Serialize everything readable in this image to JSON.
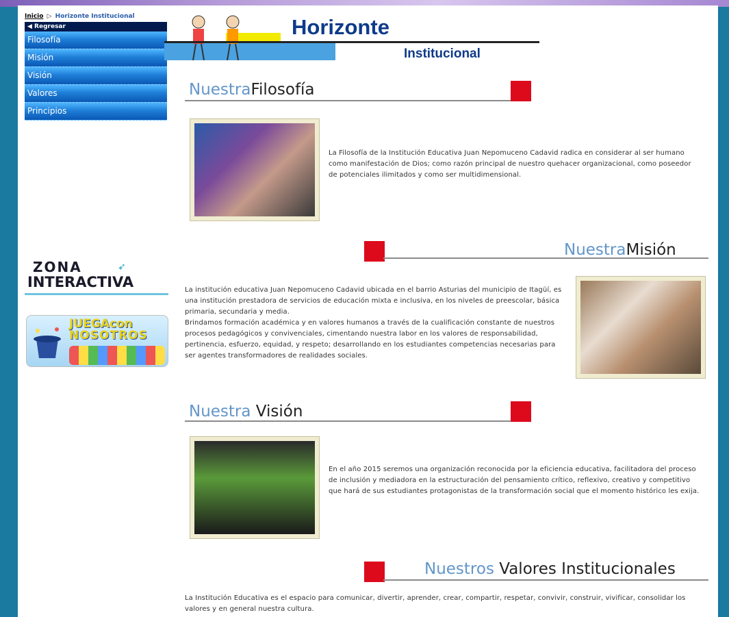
{
  "breadcrumb": {
    "home": "Inicio",
    "separator": "▷",
    "current": "Horizonte Institucional"
  },
  "sidebar": {
    "back_label": "◀ Regresar",
    "items": [
      "Filosofía",
      "Misión",
      "Visión",
      "Valores",
      "Principios"
    ]
  },
  "zona": {
    "line1": "ZONA",
    "line2": "INTERACTIVA"
  },
  "juega": {
    "line1": "JUEGAcon",
    "line2": "NOSOTROS"
  },
  "header": {
    "title": "Horizonte",
    "subtitle": "Institucional"
  },
  "sections": [
    {
      "title_light": "Nuestra",
      "title_dark": "Filosofía",
      "text": "La Filosofía de la Institución Educativa Juan Nepomuceno Cadavid radica en considerar al ser humano como manifestación de Dios; como razón principal de nuestro quehacer organizacional, como poseedor de potenciales ilimitados y como ser multidimensional."
    },
    {
      "title_light": "Nuestra",
      "title_dark": "Misión",
      "text": "La institución educativa Juan Nepomuceno Cadavid ubicada en el barrio Asturias del municipio de Itagüí, es una institución prestadora de servicios de educación mixta e inclusiva, en los niveles de preescolar, básica primaria, secundaria y media.\nBrindamos formación académica y en valores humanos a través de la cualificación constante de nuestros procesos pedagógicos y convivenciales, cimentando nuestra labor en los valores de responsabilidad, pertinencia, esfuerzo, equidad, y respeto; desarrollando en los estudiantes competencias necesarias para ser agentes transformadores de realidades sociales."
    },
    {
      "title_light": "Nuestra",
      "title_dark": "Visión",
      "text": "En el año 2015 seremos una organización reconocida por la eficiencia educativa, facilitadora del proceso de inclusión y mediadora en la estructuración del pensamiento crítico, reflexivo, creativo y competitivo que hará de sus estudiantes protagonistas de la transformación social que el momento histórico les exija."
    },
    {
      "title_light": "Nuestros",
      "title_dark": "Valores Institucionales",
      "text": "La Institución Educativa es el espacio para comunicar, divertir, aprender, crear, compartir, respetar, convivir, construir, vivificar, consolidar los valores y en general nuestra cultura."
    }
  ],
  "colors": {
    "accent_red": "#dd0a1c",
    "title_blue": "#0e3a8a",
    "nav_blue": "#1f7fd8"
  }
}
